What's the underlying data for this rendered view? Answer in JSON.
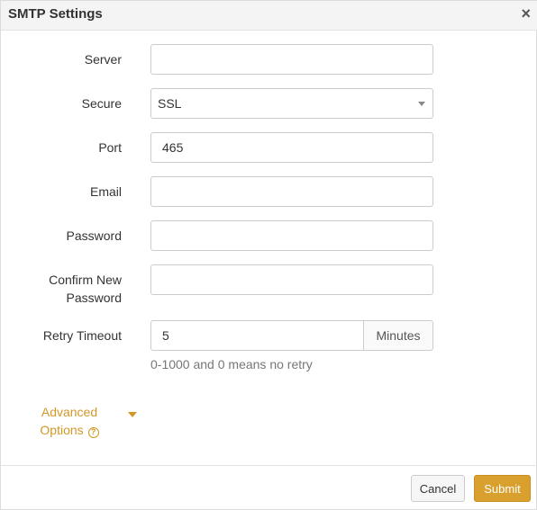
{
  "dialog": {
    "title": "SMTP Settings",
    "close_glyph": "×"
  },
  "form": {
    "server": {
      "label": "Server",
      "value": ""
    },
    "secure": {
      "label": "Secure",
      "value": "SSL"
    },
    "port": {
      "label": "Port",
      "value": "465"
    },
    "email": {
      "label": "Email",
      "value": ""
    },
    "password": {
      "label": "Password",
      "value": ""
    },
    "confirm_password": {
      "label_line1": "Confirm New",
      "label_line2": "Password",
      "value": ""
    },
    "retry_timeout": {
      "label": "Retry Timeout",
      "value": "5",
      "unit": "Minutes",
      "help": "0-1000 and 0 means no retry"
    }
  },
  "advanced": {
    "label_line1": "Advanced",
    "label_line2": "Options",
    "help_icon": "question-circle-icon",
    "caret_icon": "caret-down-icon"
  },
  "footer": {
    "cancel_label": "Cancel",
    "submit_label": "Submit"
  },
  "colors": {
    "accent": "#d9a02e",
    "link": "#d39728",
    "header_bg": "#f4f4f4"
  }
}
